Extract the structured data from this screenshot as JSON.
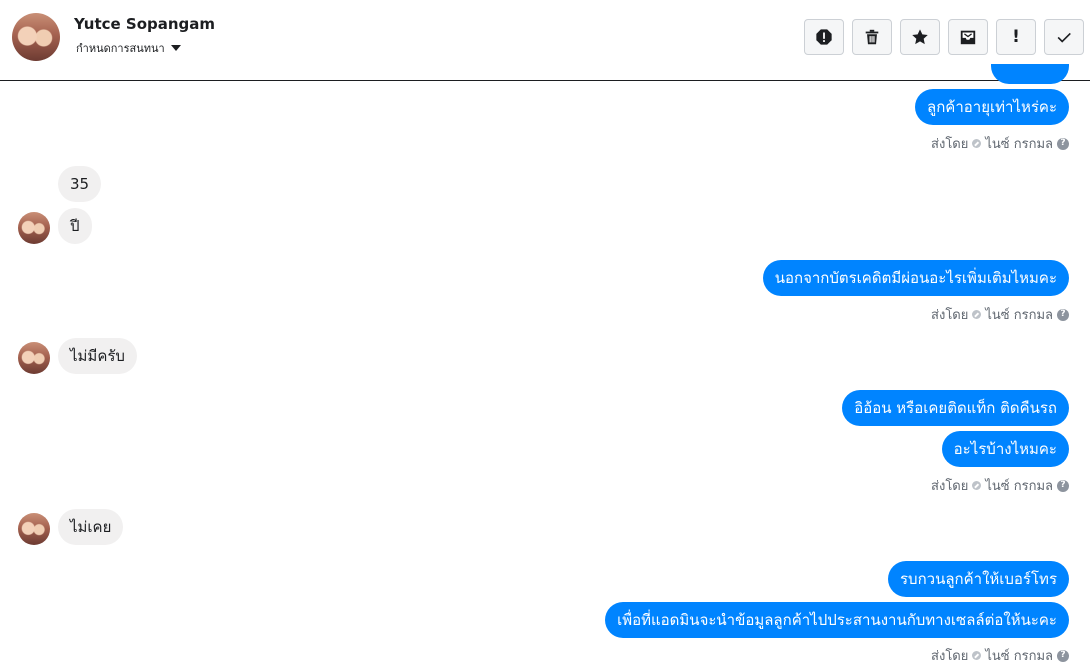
{
  "header": {
    "name": "Yutce Sopangam",
    "subtitle": "กำหนดการสนทนา"
  },
  "toolbar": {
    "buttons": [
      {
        "icon": "alert-circle-icon"
      },
      {
        "icon": "trash-icon"
      },
      {
        "icon": "star-icon"
      },
      {
        "icon": "archive-inbox-icon"
      },
      {
        "icon": "exclamation-icon",
        "glyph": "!"
      },
      {
        "icon": "checkmark-icon"
      }
    ]
  },
  "messages": {
    "out1": "ลูกค้าอายุเท่าไหร่คะ",
    "in1": "35",
    "in2": "ปี",
    "out2": "นอกจากบัตรเคดิตมีผ่อนอะไรเพิ่มเติมไหมคะ",
    "in3": "ไม่มีครับ",
    "out3": "อิอ้อน หรือเคยติดแท็ก ติดคืนรถ",
    "out4": "อะไรบ้างไหมคะ",
    "in4": "ไม่เคย",
    "out5": "รบกวนลูกค้าให้เบอร์โทร",
    "out6": "เพื่อที่แอดมินจะนำข้อมูลลูกค้าไปประสานงานกับทางเซลล์ต่อให้นะคะ"
  },
  "meta": {
    "sent_by": "ส่งโดย",
    "sender": "ไนซ์ กรกมล",
    "help": "?"
  }
}
